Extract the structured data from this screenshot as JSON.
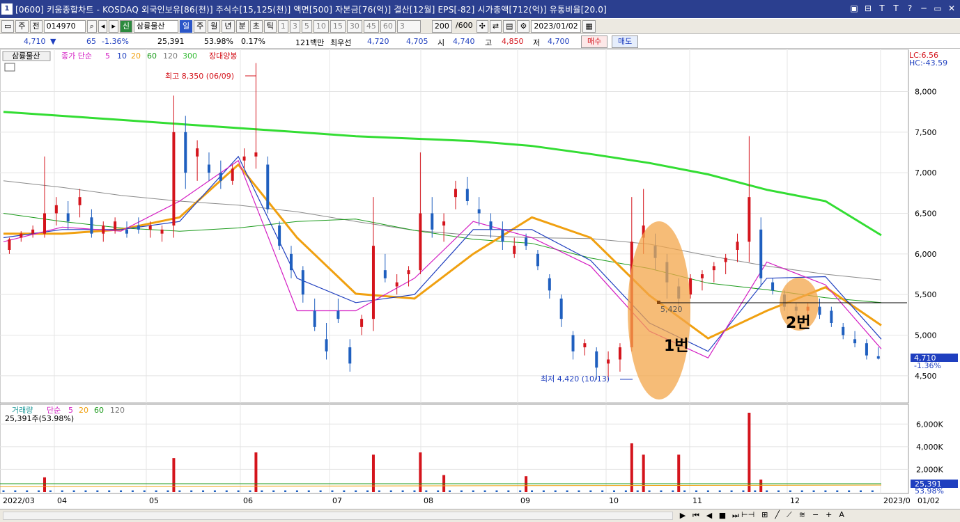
{
  "window": {
    "number": "1",
    "title": "[0600] 키움종합차트 - KOSDAQ 외국인보유[86(천)] 주식수[15,125(천)] 액면[500] 자본금[76(억)] 결산[12월] EPS[-82] 시가총액[712(억)] 유통비율[20.0]",
    "controls": [
      "▣",
      "⊟",
      "T",
      "T",
      "?",
      "─",
      "▭",
      "✕"
    ]
  },
  "toolbar": {
    "mode": "주",
    "type_btn": "전",
    "code": "014970",
    "credit_badge": "신",
    "stock_name": "삼륭물산",
    "periods": [
      "일",
      "주",
      "월",
      "년",
      "분",
      "초",
      "틱"
    ],
    "active_period": "일",
    "intervals": [
      "1",
      "3",
      "5",
      "10",
      "15",
      "30",
      "45",
      "60"
    ],
    "interval_input": "3",
    "count": "200",
    "count_max": "/600",
    "date": "2023/01/02"
  },
  "quote": {
    "price": "4,710",
    "direction_icon": "▼",
    "change": "65",
    "change_pct": "-1.36%",
    "volume": "25,391",
    "vol_ratio": "53.98%",
    "turnover": "0.17%",
    "trade_value": "121백만",
    "best_label": "최우선",
    "best_bid": "4,720",
    "best_ask": "4,705",
    "open_label": "시",
    "open": "4,740",
    "high_label": "고",
    "high": "4,850",
    "low_label": "저",
    "low": "4,700",
    "buy_label": "매수",
    "sell_label": "매도"
  },
  "chart_data": {
    "type": "candlestick",
    "legend": {
      "stock": "삼륭물산",
      "ma_label": "종가 단순",
      "ma_periods": [
        "5",
        "10",
        "20",
        "60",
        "120",
        "300"
      ],
      "ma_colors": [
        "#d41ec3",
        "#1f3fbf",
        "#f0a010",
        "#1a9a1a",
        "#7a7a7a",
        "#33dd33"
      ],
      "pattern": "장대양봉"
    },
    "corner": {
      "lc": "LC:6.56",
      "hc": "HC:-43.59"
    },
    "y_ticks": [
      "8,000",
      "7,500",
      "7,000",
      "6,500",
      "6,000",
      "5,500",
      "5,000",
      "4,500"
    ],
    "ylim": [
      4250,
      8450
    ],
    "x_labels": [
      "2022/03",
      "04",
      "05",
      "06",
      "07",
      "08",
      "09",
      "10",
      "11",
      "12",
      "2023/0",
      "01/02"
    ],
    "annotations": {
      "high": "최고 8,350 (06/09)",
      "low": "최저 4,420 (10/13)",
      "level": "5,420",
      "mark1": "1번",
      "mark2": "2번"
    },
    "current_price": "4,710",
    "current_pct": "-1.36%",
    "ma300": [
      [
        0,
        7750
      ],
      [
        20,
        7700
      ],
      [
        40,
        7650
      ],
      [
        60,
        7600
      ],
      [
        80,
        7550
      ],
      [
        100,
        7500
      ],
      [
        120,
        7450
      ],
      [
        140,
        7420
      ],
      [
        160,
        7390
      ],
      [
        180,
        7330
      ],
      [
        200,
        7230
      ],
      [
        220,
        7120
      ],
      [
        240,
        6980
      ],
      [
        260,
        6790
      ],
      [
        280,
        6650
      ],
      [
        299,
        6230
      ]
    ],
    "ma120": [
      [
        0,
        6900
      ],
      [
        20,
        6820
      ],
      [
        40,
        6720
      ],
      [
        60,
        6650
      ],
      [
        80,
        6600
      ],
      [
        100,
        6520
      ],
      [
        120,
        6400
      ],
      [
        140,
        6290
      ],
      [
        160,
        6230
      ],
      [
        180,
        6200
      ],
      [
        200,
        6190
      ],
      [
        220,
        6120
      ],
      [
        240,
        5980
      ],
      [
        260,
        5850
      ],
      [
        280,
        5750
      ],
      [
        299,
        5680
      ]
    ],
    "ma60": [
      [
        0,
        6500
      ],
      [
        20,
        6400
      ],
      [
        40,
        6320
      ],
      [
        60,
        6280
      ],
      [
        80,
        6320
      ],
      [
        100,
        6400
      ],
      [
        120,
        6430
      ],
      [
        140,
        6290
      ],
      [
        160,
        6180
      ],
      [
        180,
        6130
      ],
      [
        200,
        5950
      ],
      [
        220,
        5820
      ],
      [
        240,
        5640
      ],
      [
        260,
        5560
      ],
      [
        280,
        5460
      ],
      [
        299,
        5400
      ]
    ],
    "ma20": [
      [
        0,
        6250
      ],
      [
        20,
        6250
      ],
      [
        40,
        6300
      ],
      [
        60,
        6450
      ],
      [
        80,
        7100
      ],
      [
        100,
        6200
      ],
      [
        120,
        5510
      ],
      [
        140,
        5450
      ],
      [
        160,
        6000
      ],
      [
        180,
        6450
      ],
      [
        200,
        6200
      ],
      [
        220,
        5490
      ],
      [
        240,
        4960
      ],
      [
        260,
        5300
      ],
      [
        280,
        5590
      ],
      [
        299,
        5120
      ]
    ],
    "ma10": [
      [
        0,
        6200
      ],
      [
        20,
        6300
      ],
      [
        40,
        6300
      ],
      [
        60,
        6400
      ],
      [
        80,
        7200
      ],
      [
        100,
        5700
      ],
      [
        120,
        5400
      ],
      [
        140,
        5500
      ],
      [
        160,
        6300
      ],
      [
        180,
        6300
      ],
      [
        200,
        5920
      ],
      [
        220,
        5150
      ],
      [
        240,
        4800
      ],
      [
        260,
        5700
      ],
      [
        280,
        5720
      ],
      [
        299,
        4950
      ]
    ],
    "ma5": [
      [
        0,
        6150
      ],
      [
        20,
        6330
      ],
      [
        40,
        6280
      ],
      [
        60,
        6650
      ],
      [
        80,
        7150
      ],
      [
        100,
        5300
      ],
      [
        120,
        5300
      ],
      [
        140,
        5700
      ],
      [
        160,
        6400
      ],
      [
        180,
        6200
      ],
      [
        200,
        5850
      ],
      [
        220,
        5050
      ],
      [
        240,
        4720
      ],
      [
        260,
        5900
      ],
      [
        280,
        5620
      ],
      [
        299,
        4830
      ]
    ],
    "candles": [
      [
        2,
        6050,
        6200,
        6000,
        6180
      ],
      [
        6,
        6200,
        6280,
        6150,
        6250
      ],
      [
        10,
        6250,
        6350,
        6200,
        6300
      ],
      [
        14,
        6250,
        7200,
        6200,
        6500
      ],
      [
        18,
        6500,
        6700,
        6350,
        6600
      ],
      [
        22,
        6500,
        6650,
        6300,
        6400
      ],
      [
        26,
        6600,
        6800,
        6450,
        6700
      ],
      [
        30,
        6450,
        6550,
        6200,
        6250
      ],
      [
        34,
        6250,
        6400,
        6150,
        6350
      ],
      [
        38,
        6300,
        6450,
        6250,
        6400
      ],
      [
        42,
        6300,
        6400,
        6200,
        6250
      ],
      [
        46,
        6350,
        6450,
        6250,
        6300
      ],
      [
        50,
        6300,
        6400,
        6200,
        6350
      ],
      [
        54,
        6250,
        6350,
        6150,
        6300
      ],
      [
        58,
        6350,
        7950,
        6200,
        7500
      ],
      [
        62,
        7500,
        7700,
        6800,
        7000
      ],
      [
        66,
        7200,
        7400,
        6900,
        7300
      ],
      [
        70,
        7100,
        7250,
        6900,
        7000
      ],
      [
        74,
        7000,
        7150,
        6800,
        6900
      ],
      [
        78,
        6900,
        7100,
        6850,
        7050
      ],
      [
        82,
        7150,
        7300,
        7050,
        7200
      ],
      [
        86,
        7200,
        8350,
        7050,
        7250
      ],
      [
        90,
        7100,
        7200,
        6500,
        6550
      ],
      [
        94,
        6350,
        6400,
        6050,
        6100
      ],
      [
        98,
        6000,
        6100,
        5700,
        5800
      ],
      [
        102,
        5800,
        5850,
        5400,
        5500
      ],
      [
        106,
        5300,
        5450,
        5050,
        5100
      ],
      [
        110,
        4950,
        5150,
        4700,
        4800
      ],
      [
        114,
        5300,
        5450,
        5150,
        5200
      ],
      [
        118,
        4850,
        4950,
        4550,
        4650
      ],
      [
        122,
        5100,
        5250,
        5000,
        5200
      ],
      [
        126,
        5200,
        6700,
        5050,
        6100
      ],
      [
        130,
        5800,
        6000,
        5650,
        5700
      ],
      [
        134,
        5600,
        5750,
        5500,
        5650
      ],
      [
        138,
        5750,
        5850,
        5600,
        5800
      ],
      [
        142,
        5800,
        7250,
        5750,
        6500
      ],
      [
        146,
        6500,
        6700,
        6200,
        6300
      ],
      [
        150,
        6350,
        6500,
        6150,
        6400
      ],
      [
        154,
        6700,
        6900,
        6550,
        6800
      ],
      [
        158,
        6800,
        6950,
        6600,
        6650
      ],
      [
        162,
        6550,
        6700,
        6350,
        6500
      ],
      [
        166,
        6400,
        6500,
        6200,
        6300
      ],
      [
        170,
        6300,
        6400,
        6050,
        6150
      ],
      [
        174,
        6000,
        6200,
        5950,
        6100
      ],
      [
        178,
        6200,
        6250,
        6050,
        6100
      ],
      [
        182,
        6000,
        6050,
        5800,
        5850
      ],
      [
        186,
        5700,
        5750,
        5450,
        5550
      ],
      [
        190,
        5450,
        5500,
        5100,
        5200
      ],
      [
        194,
        5000,
        5050,
        4700,
        4800
      ],
      [
        198,
        4850,
        4950,
        4750,
        4900
      ],
      [
        202,
        4800,
        4850,
        4450,
        4600
      ],
      [
        206,
        4650,
        4800,
        4450,
        4700
      ],
      [
        210,
        4700,
        4900,
        4550,
        4850
      ],
      [
        214,
        4850,
        6700,
        4800,
        6150
      ],
      [
        218,
        6200,
        6800,
        6000,
        6350
      ],
      [
        222,
        6100,
        6250,
        5800,
        5950
      ],
      [
        226,
        5900,
        6000,
        5450,
        5650
      ],
      [
        230,
        5600,
        5700,
        5300,
        5450
      ],
      [
        234,
        5500,
        5750,
        5450,
        5700
      ],
      [
        238,
        5700,
        5800,
        5550,
        5750
      ],
      [
        242,
        5800,
        5900,
        5650,
        5850
      ],
      [
        246,
        5900,
        6000,
        5750,
        5950
      ],
      [
        250,
        6050,
        6250,
        5900,
        6150
      ],
      [
        254,
        6150,
        7450,
        5900,
        6700
      ],
      [
        258,
        6300,
        6450,
        5600,
        5700
      ],
      [
        262,
        5650,
        5700,
        5500,
        5550
      ],
      [
        266,
        5500,
        5550,
        5300,
        5350
      ],
      [
        270,
        5350,
        5400,
        5200,
        5300
      ],
      [
        274,
        5300,
        5400,
        5250,
        5350
      ],
      [
        278,
        5350,
        5450,
        5200,
        5250
      ],
      [
        282,
        5300,
        5350,
        5100,
        5150
      ],
      [
        286,
        5100,
        5150,
        4950,
        5000
      ],
      [
        290,
        4950,
        5050,
        4850,
        4900
      ],
      [
        294,
        4900,
        4950,
        4700,
        4750
      ],
      [
        298,
        4740,
        4850,
        4700,
        4710
      ]
    ],
    "volume_panel": {
      "legend_label": "거래량",
      "ma_label": "단순",
      "ma_periods": [
        "5",
        "20",
        "60",
        "120"
      ],
      "info": "25,391주(53.98%)",
      "y_ticks": [
        "6,000K",
        "4,000K",
        "2,000K"
      ],
      "ylim": [
        0,
        7000
      ],
      "current": "25,391",
      "current_pct": "53.98%",
      "bars": [
        [
          14,
          1300
        ],
        [
          58,
          3000
        ],
        [
          86,
          3500
        ],
        [
          126,
          3300
        ],
        [
          142,
          3500
        ],
        [
          150,
          1500
        ],
        [
          178,
          1400
        ],
        [
          214,
          4300
        ],
        [
          218,
          3300
        ],
        [
          230,
          3300
        ],
        [
          254,
          7000
        ],
        [
          258,
          1100
        ]
      ]
    }
  }
}
